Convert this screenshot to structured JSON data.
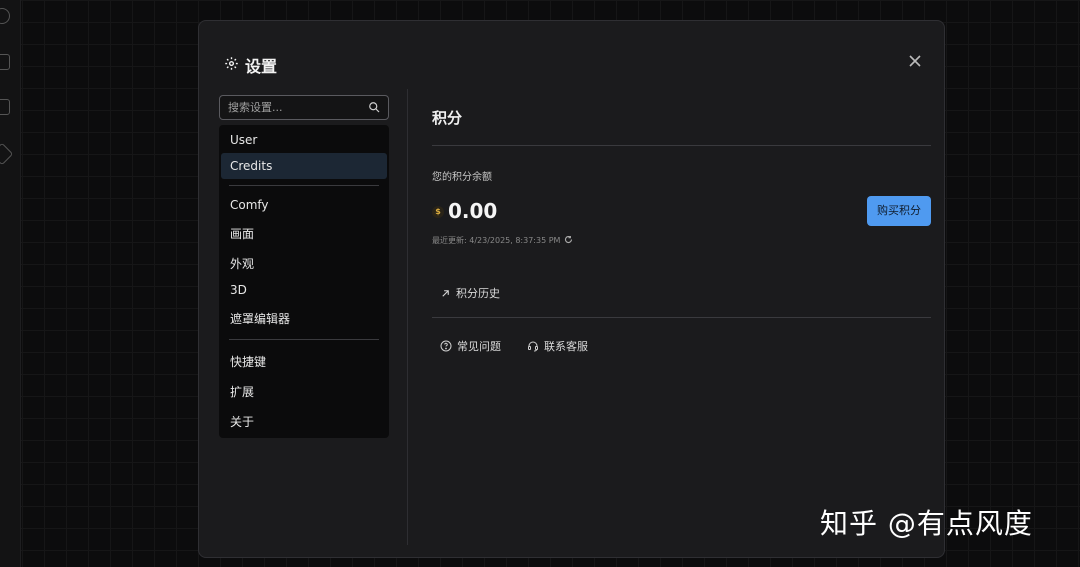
{
  "settings": {
    "title": "设置",
    "search_placeholder": "搜索设置...",
    "nav": [
      "User",
      "Credits",
      "Comfy",
      "画面",
      "外观",
      "3D",
      "遮罩编辑器",
      "快捷键",
      "扩展",
      "关于"
    ],
    "active_nav": "Credits"
  },
  "credits": {
    "title": "积分",
    "balance_label": "您的积分余额",
    "coin_symbol": "$",
    "balance_value": "0.00",
    "buy_button": "购买积分",
    "last_updated": "最近更新: 4/23/2025, 8:37:35 PM",
    "history_link": "积分历史",
    "faq_link": "常见问题",
    "support_link": "联系客服"
  },
  "watermark": "知乎 @有点风度",
  "colors": {
    "accent": "#4f9af0",
    "active_nav_bg": "#1c2734",
    "modal_bg": "#1b1b1d",
    "coin": "#e0b040"
  },
  "icons": {
    "title": "gear-icon",
    "close": "close-icon",
    "search": "search-icon",
    "history": "arrow-up-right-icon",
    "faq": "help-circle-icon",
    "support": "headset-icon",
    "refresh": "refresh-icon",
    "coin": "coin-icon"
  }
}
